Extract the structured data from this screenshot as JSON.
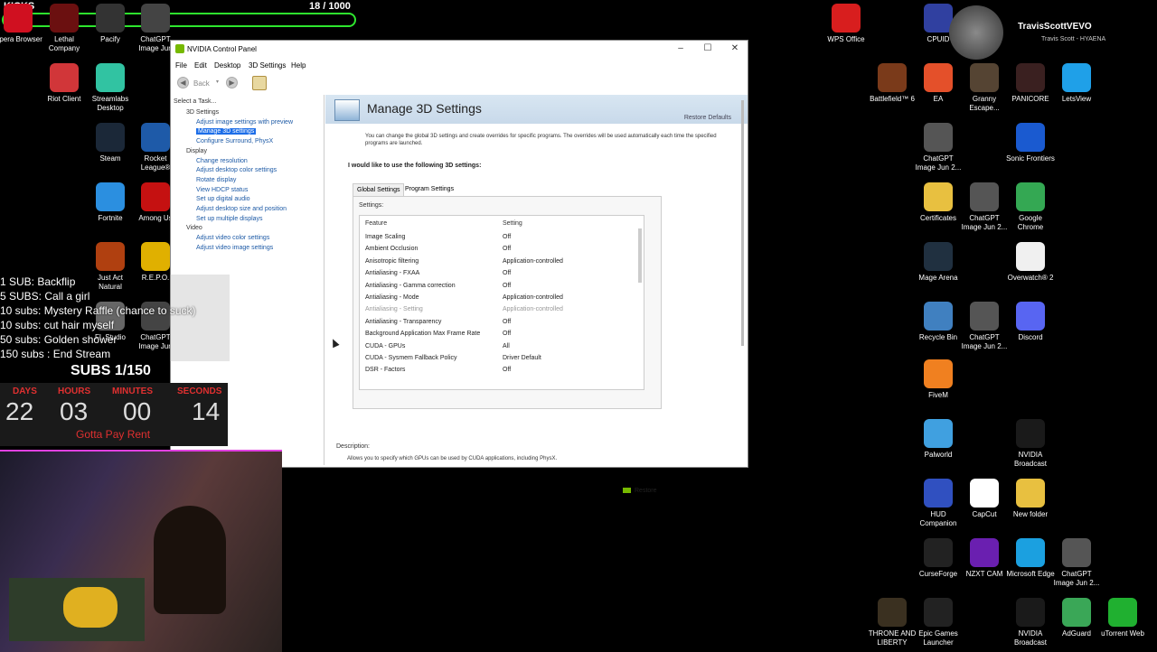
{
  "kicks": {
    "title": "KICKS",
    "count": "18 / 1000",
    "progress": 0.018,
    "accent": "#2ee62e"
  },
  "desktop_left": [
    {
      "label": "Opera Browser",
      "icon": "opera-icon",
      "color": "#d01020"
    },
    {
      "label": "Lethal Company",
      "icon": "lethal-company-icon",
      "color": "#6b1010"
    },
    {
      "label": "Pacify",
      "icon": "pacify-icon",
      "color": "#333333"
    },
    {
      "label": "ChatGPT Image Jun",
      "icon": "image-file-icon",
      "color": "#444444"
    },
    {
      "label": "Riot Client",
      "icon": "riot-client-icon",
      "color": "#d13639"
    },
    {
      "label": "Streamlabs Desktop",
      "icon": "streamlabs-icon",
      "color": "#31c3a2"
    },
    {
      "label": "Steam",
      "icon": "steam-icon",
      "color": "#1b2838"
    },
    {
      "label": "Rocket League®",
      "icon": "rocket-league-icon",
      "color": "#1e5aa8"
    },
    {
      "label": "Fortnite",
      "icon": "fortnite-icon",
      "color": "#2b8fe0"
    },
    {
      "label": "Among Us",
      "icon": "among-us-icon",
      "color": "#c51111"
    },
    {
      "label": "Just Act Natural",
      "icon": "just-act-natural-icon",
      "color": "#b04010"
    },
    {
      "label": "R.E.P.O.",
      "icon": "repo-icon",
      "color": "#e0b000"
    },
    {
      "label": "FL Studio",
      "icon": "fl-studio-icon",
      "color": "#666666"
    },
    {
      "label": "ChatGPT Image Jun",
      "icon": "image-file-icon",
      "color": "#444444"
    }
  ],
  "desktop_right": [
    {
      "label": "WPS Office",
      "icon": "wps-office-icon",
      "color": "#d81e1e"
    },
    {
      "label": "CPUID",
      "icon": "cpuid-icon",
      "color": "#3040a0"
    },
    {
      "label": "Battlefield™ 6",
      "icon": "battlefield-icon",
      "color": "#7a3a1a"
    },
    {
      "label": "EA",
      "icon": "ea-icon",
      "color": "#e4502a"
    },
    {
      "label": "Granny Escape...",
      "icon": "granny-icon",
      "color": "#554433"
    },
    {
      "label": "PANICORE",
      "icon": "panicore-icon",
      "color": "#3a2020"
    },
    {
      "label": "LetsView",
      "icon": "letsview-icon",
      "color": "#1fa0e8"
    },
    {
      "label": "ChatGPT Image Jun 2...",
      "icon": "image-file-icon",
      "color": "#555555"
    },
    {
      "label": "Sonic Frontiers",
      "icon": "sonic-icon",
      "color": "#1a5ad0"
    },
    {
      "label": "Certificates",
      "icon": "folder-icon",
      "color": "#e8c040"
    },
    {
      "label": "ChatGPT Image Jun 2...",
      "icon": "image-file-icon",
      "color": "#555555"
    },
    {
      "label": "Google Chrome",
      "icon": "chrome-icon",
      "color": "#34a853"
    },
    {
      "label": "Mage Arena",
      "icon": "mage-arena-icon",
      "color": "#203040"
    },
    {
      "label": "Overwatch® 2",
      "icon": "overwatch-icon",
      "color": "#f0f0f0"
    },
    {
      "label": "Recycle Bin",
      "icon": "recycle-bin-icon",
      "color": "#4080c0"
    },
    {
      "label": "ChatGPT Image Jun 2...",
      "icon": "image-file-icon",
      "color": "#555555"
    },
    {
      "label": "Discord",
      "icon": "discord-icon",
      "color": "#5865f2"
    },
    {
      "label": "FiveM",
      "icon": "fivem-icon",
      "color": "#f08020"
    },
    {
      "label": "Palworld",
      "icon": "palworld-icon",
      "color": "#40a0e0"
    },
    {
      "label": "NVIDIA Broadcast",
      "icon": "nvidia-broadcast-icon",
      "color": "#1a1a1a"
    },
    {
      "label": "HUD Companion",
      "icon": "hud-fx-icon",
      "color": "#3050c0"
    },
    {
      "label": "CapCut",
      "icon": "capcut-icon",
      "color": "#ffffff"
    },
    {
      "label": "New folder",
      "icon": "folder-icon",
      "color": "#e8c040"
    },
    {
      "label": "CurseForge",
      "icon": "curseforge-icon",
      "color": "#222222"
    },
    {
      "label": "NZXT CAM",
      "icon": "nzxt-cam-icon",
      "color": "#6a1fb0"
    },
    {
      "label": "Microsoft Edge",
      "icon": "edge-icon",
      "color": "#1ba0e0"
    },
    {
      "label": "ChatGPT Image Jun 2...",
      "icon": "image-file-icon",
      "color": "#555555"
    },
    {
      "label": "THRONE AND LIBERTY",
      "icon": "throne-liberty-icon",
      "color": "#3a3020"
    },
    {
      "label": "Epic Games Launcher",
      "icon": "epic-games-icon",
      "color": "#222222"
    },
    {
      "label": "NVIDIA Broadcast",
      "icon": "nvidia-broadcast-icon",
      "color": "#1a1a1a"
    },
    {
      "label": "AdGuard",
      "icon": "adguard-icon",
      "color": "#3aa757"
    },
    {
      "label": "uTorrent Web",
      "icon": "utorrent-icon",
      "color": "#20b030"
    }
  ],
  "streamer": {
    "name": "TravisScottVEVO",
    "track": "Travis Scott - HYAENA"
  },
  "window": {
    "title": "NVIDIA Control Panel",
    "menu": [
      "File",
      "Edit",
      "Desktop",
      "3D Settings",
      "Help"
    ],
    "back_label": "Back",
    "select_task": "Select a Task...",
    "tree": [
      {
        "label": "3D Settings",
        "type": "cat"
      },
      {
        "label": "Adjust image settings with preview",
        "type": "item"
      },
      {
        "label": "Manage 3D settings",
        "type": "selected"
      },
      {
        "label": "Configure Surround, PhysX",
        "type": "item"
      },
      {
        "label": "Display",
        "type": "cat"
      },
      {
        "label": "Change resolution",
        "type": "item"
      },
      {
        "label": "Adjust desktop color settings",
        "type": "item"
      },
      {
        "label": "Rotate display",
        "type": "item"
      },
      {
        "label": "View HDCP status",
        "type": "item"
      },
      {
        "label": "Set up digital audio",
        "type": "item"
      },
      {
        "label": "Adjust desktop size and position",
        "type": "item"
      },
      {
        "label": "Set up multiple displays",
        "type": "item"
      },
      {
        "label": "Video",
        "type": "cat"
      },
      {
        "label": "Adjust video color settings",
        "type": "item"
      },
      {
        "label": "Adjust video image settings",
        "type": "item"
      }
    ],
    "page_title": "Manage 3D Settings",
    "restore_defaults": "Restore Defaults",
    "intro": "You can change the global 3D settings and create overrides for specific programs. The overrides will be used automatically each time the specified programs are launched.",
    "like_label": "I would like to use the following 3D settings:",
    "tabs": [
      "Global Settings",
      "Program Settings"
    ],
    "settings_label": "Settings:",
    "col_feature": "Feature",
    "col_setting": "Setting",
    "rows": [
      {
        "feature": "Image Scaling",
        "value": "Off",
        "disabled": false
      },
      {
        "feature": "Ambient Occlusion",
        "value": "Off",
        "disabled": false
      },
      {
        "feature": "Anisotropic filtering",
        "value": "Application-controlled",
        "disabled": false
      },
      {
        "feature": "Antialiasing - FXAA",
        "value": "Off",
        "disabled": false
      },
      {
        "feature": "Antialiasing - Gamma correction",
        "value": "Off",
        "disabled": false
      },
      {
        "feature": "Antialiasing - Mode",
        "value": "Application-controlled",
        "disabled": false
      },
      {
        "feature": "Antialiasing - Setting",
        "value": "Application-controlled",
        "disabled": true
      },
      {
        "feature": "Antialiasing - Transparency",
        "value": "Off",
        "disabled": false
      },
      {
        "feature": "Background Application Max Frame Rate",
        "value": "Off",
        "disabled": false
      },
      {
        "feature": "CUDA - GPUs",
        "value": "All",
        "disabled": false
      },
      {
        "feature": "CUDA - Sysmem Fallback Policy",
        "value": "Driver Default",
        "disabled": false
      },
      {
        "feature": "DSR - Factors",
        "value": "Off",
        "disabled": false
      }
    ],
    "restore_label": "Restore",
    "description_label": "Description:",
    "description_text": "Allows you to specify which GPUs can be used by CUDA applications, including PhysX."
  },
  "overlay": {
    "goals": [
      "1 SUB: Backflip",
      "5 SUBS: Call a girl",
      "10 subs: Mystery Raffle (chance to suck)",
      "10 subs: cut hair myself",
      "50 subs: Golden shower",
      "150 subs : End Stream"
    ],
    "subs_counter": "SUBS 1/150",
    "timer_labels": [
      "DAYS",
      "HOURS",
      "MINUTES",
      "SECONDS"
    ],
    "timer_values": [
      "22",
      "03",
      "00",
      "14"
    ],
    "timer_caption": "Gotta Pay Rent"
  }
}
